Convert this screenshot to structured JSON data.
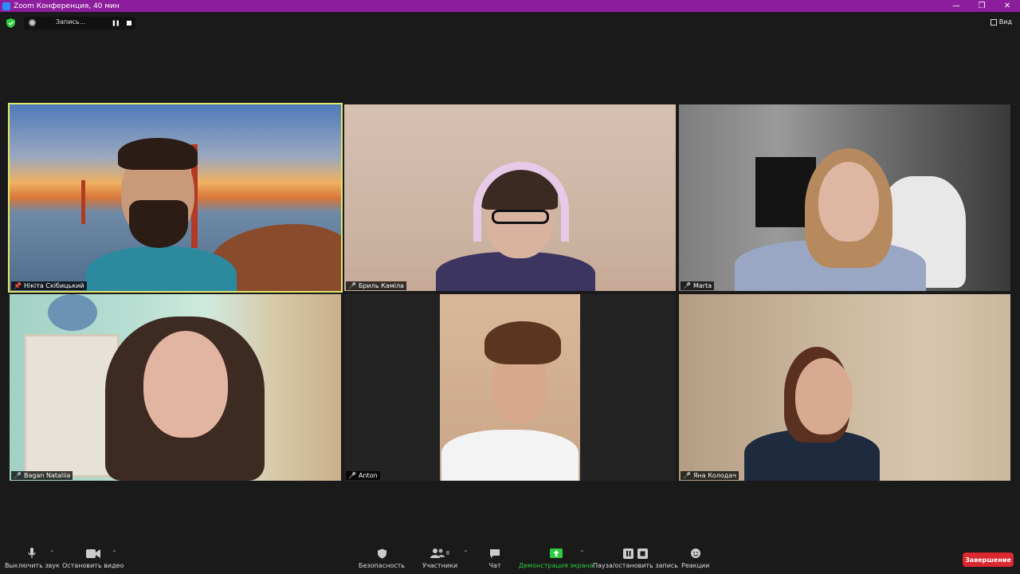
{
  "window": {
    "title": "Zoom Конференция, 40 мин",
    "minimize": "—",
    "maximize": "❐",
    "close": "✕"
  },
  "recording": {
    "label": "Запись...",
    "pause": "❚❚"
  },
  "view": {
    "label": "Вид"
  },
  "participants": [
    {
      "name": "Нікіта Скібицький",
      "muted": false,
      "pinned": true,
      "active": true
    },
    {
      "name": "Бриль Каміла",
      "muted": true
    },
    {
      "name": "Marta",
      "muted": true
    },
    {
      "name": "Bagan Nataliia",
      "muted": true
    },
    {
      "name": "Anton",
      "muted": true
    },
    {
      "name": "Яна Колодач",
      "muted": true
    }
  ],
  "toolbar": {
    "mute": "Выключить звук",
    "video": "Остановить видео",
    "security": "Безопасность",
    "participants": "Участники",
    "participants_count": "8",
    "chat": "Чат",
    "share": "Демонстрация экрана",
    "record": "Пауза/остановить запись",
    "reactions": "Реакции",
    "end": "Завершение"
  },
  "colors": {
    "accent": "#2ecc40",
    "end": "#d9282f",
    "titlebar": "#8c1d9c",
    "active_outline": "#e1e86b"
  }
}
